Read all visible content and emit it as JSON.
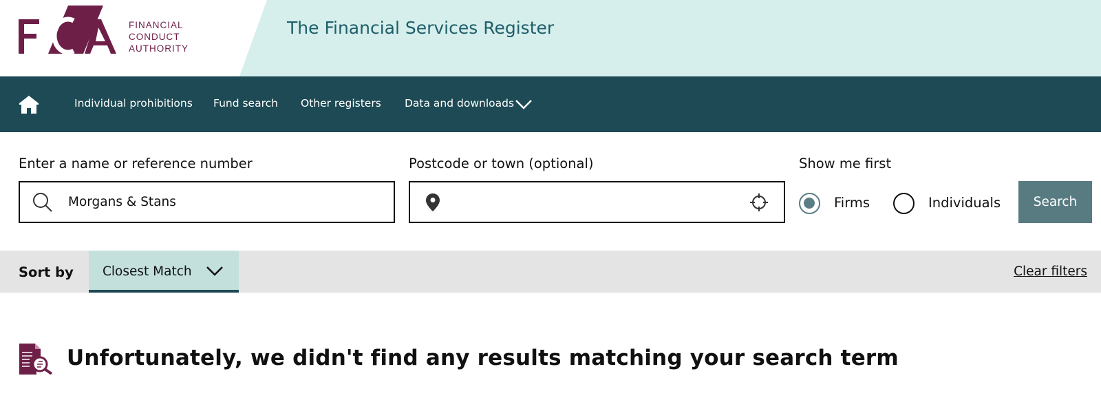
{
  "brand": {
    "logo_letters": "FCA",
    "logo_lines": [
      "FINANCIAL",
      "CONDUCT",
      "AUTHORITY"
    ],
    "site_title": "The Financial Services Register",
    "colors": {
      "plum": "#6e1f48",
      "teal_dark": "#1d4a54",
      "teal_light": "#d6eeec",
      "title_teal": "#1e5f69"
    }
  },
  "nav": {
    "home_icon": "home-icon",
    "items": [
      {
        "label": "Individual prohibitions"
      },
      {
        "label": "Fund search"
      },
      {
        "label": "Other registers"
      },
      {
        "label": "Data and downloads"
      }
    ],
    "dropdown_icon": "chevron-down-icon"
  },
  "search": {
    "name_label": "Enter a name or reference number",
    "name_value": "Morgans & Stans",
    "name_icon": "search-icon",
    "postcode_label": "Postcode or town (optional)",
    "postcode_value": "",
    "postcode_icons": [
      "location-pin-icon",
      "crosshair-icon"
    ],
    "show_first_label": "Show me first",
    "options": [
      {
        "label": "Firms",
        "checked": true
      },
      {
        "label": "Individuals",
        "checked": false
      }
    ],
    "button_label": "Search",
    "button_color": "#587b82"
  },
  "sort": {
    "label": "Sort by",
    "selected": "Closest Match",
    "clear_label": "Clear filters",
    "select_color": "#c3e0dd"
  },
  "results": {
    "icon": "document-search-icon",
    "message": "Unfortunately, we didn't find any results matching your search term"
  }
}
